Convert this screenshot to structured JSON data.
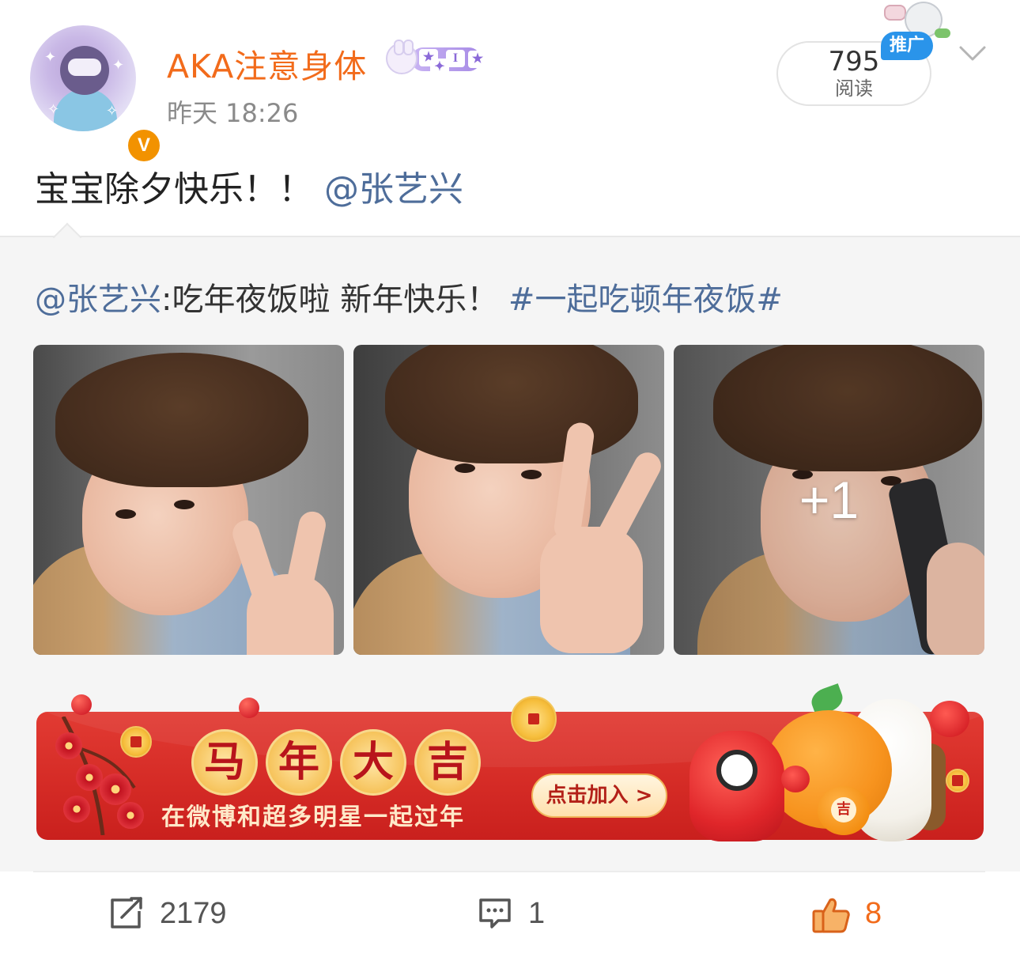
{
  "post": {
    "author": {
      "name": "AKA注意身体",
      "verified_mark": "V",
      "member_badge_letter": "I",
      "avatar": "avatar-image"
    },
    "timestamp": "昨天 18:26",
    "read_count": "795",
    "read_label": "阅读",
    "promo_tag": "推广",
    "menu_icon": "chevron-down-icon",
    "text_prefix": "宝宝除夕快乐！！",
    "text_mention": "@张艺兴"
  },
  "repost": {
    "mention": "@张艺兴",
    "text": ":吃年夜饭啦 新年快乐！",
    "hashtag": "#一起吃顿年夜饭#",
    "photos": [
      {
        "name": "photo-1",
        "alt": "selfie-peace-sign"
      },
      {
        "name": "photo-2",
        "alt": "selfie-peace-sign-closeup"
      },
      {
        "name": "photo-3",
        "alt": "selfie-phone"
      }
    ],
    "more_photos_label": "+1"
  },
  "banner": {
    "title_chars": [
      "马",
      "年",
      "大",
      "吉"
    ],
    "subtitle": "在微博和超多明星一起过年",
    "cta_label": "点击加入 >",
    "toy_badge": "吉",
    "colors": {
      "background": "#d42a25",
      "gold": "#f6c35b"
    }
  },
  "actions": {
    "repost": {
      "icon": "share-icon",
      "count": "2179"
    },
    "comment": {
      "icon": "comment-icon",
      "count": "1"
    },
    "like": {
      "icon": "thumbs-up-icon",
      "count": "8"
    }
  },
  "colors": {
    "username": "#f26b1b",
    "mention": "#4e6d9a",
    "verified": "#f29200",
    "repost_bg": "#f5f5f5",
    "like_active": "#f26b1b"
  }
}
